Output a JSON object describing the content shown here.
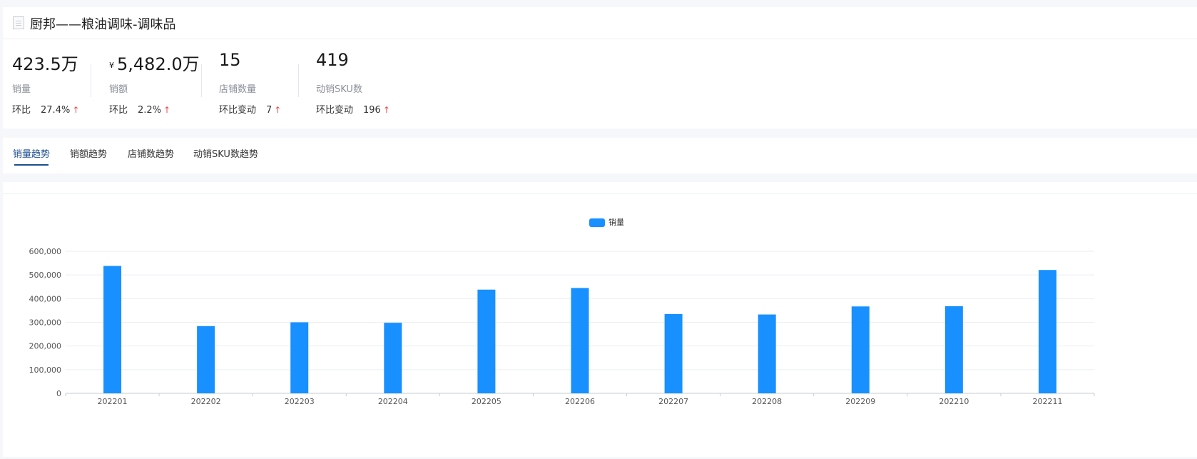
{
  "header": {
    "title": "厨邦——粮油调味-调味品"
  },
  "metrics": [
    {
      "value": "423.5万",
      "label": "销量",
      "compare_label": "环比",
      "compare_value": "27.4%",
      "trend": "up"
    },
    {
      "currency": "¥",
      "value": "5,482.0万",
      "label": "销额",
      "compare_label": "环比",
      "compare_value": "2.2%",
      "trend": "up"
    },
    {
      "value": "15",
      "label": "店铺数量",
      "compare_label": "环比变动",
      "compare_value": "7",
      "trend": "up"
    },
    {
      "value": "419",
      "label": "动销SKU数",
      "compare_label": "环比变动",
      "compare_value": "196",
      "trend": "up"
    }
  ],
  "icons": {
    "trend_up": "↑",
    "title_icon": "document-icon"
  },
  "tabs": [
    {
      "label": "销量趋势",
      "active": true
    },
    {
      "label": "销额趋势",
      "active": false
    },
    {
      "label": "店铺数趋势",
      "active": false
    },
    {
      "label": "动销SKU数趋势",
      "active": false
    }
  ],
  "colors": {
    "accent": "#1d4f91",
    "bar": "#1890ff",
    "up": "#e84a4a"
  },
  "chart_data": {
    "type": "bar",
    "categories": [
      "202201",
      "202202",
      "202203",
      "202204",
      "202205",
      "202206",
      "202207",
      "202208",
      "202209",
      "202210",
      "202211"
    ],
    "series": [
      {
        "name": "销量",
        "values": [
          538000,
          284000,
          300000,
          298000,
          438000,
          445000,
          335000,
          333000,
          367000,
          368000,
          521000
        ]
      }
    ],
    "ylim": [
      0,
      600000
    ],
    "yticks": [
      0,
      100000,
      200000,
      300000,
      400000,
      500000,
      600000
    ],
    "ytick_labels": [
      "0",
      "100,000",
      "200,000",
      "300,000",
      "400,000",
      "500,000",
      "600,000"
    ],
    "grid": true,
    "legend": "top-center"
  }
}
